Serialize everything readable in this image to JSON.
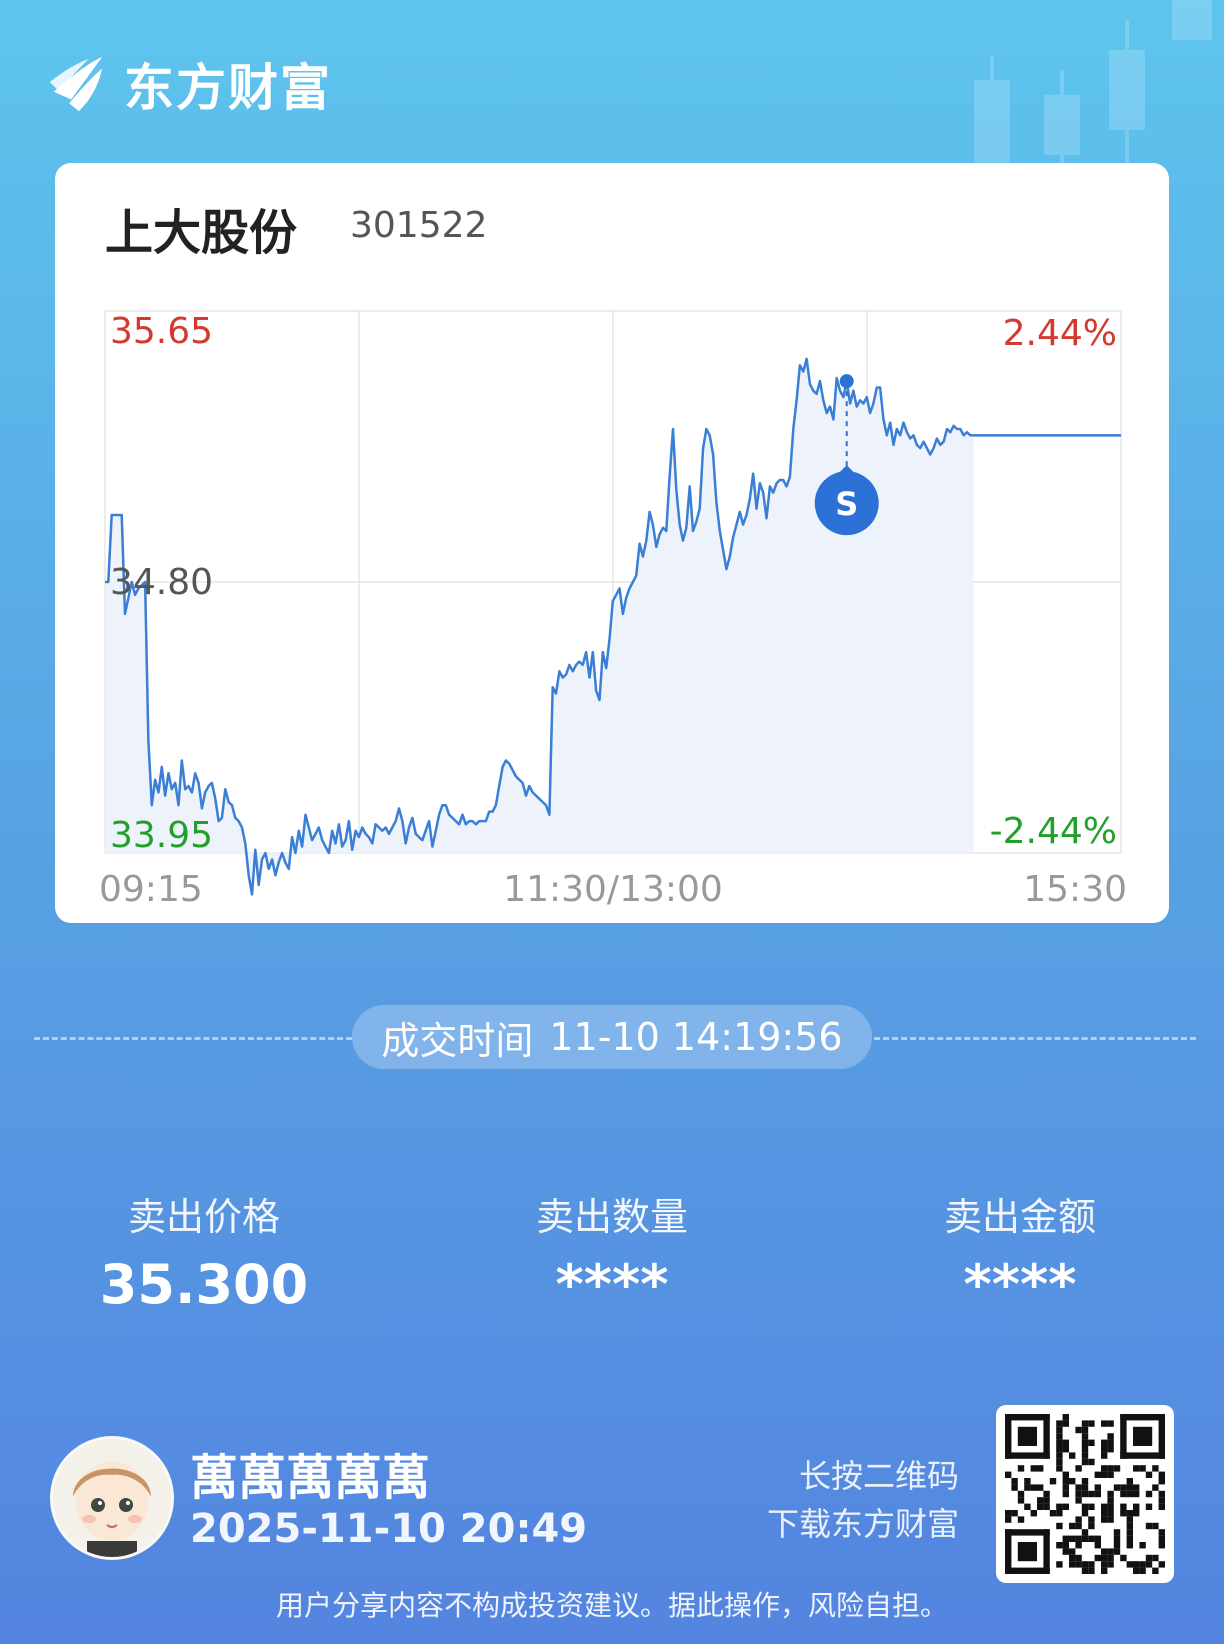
{
  "brand": {
    "name": "东方财富",
    "logo_icon": "eastmoney-logo-icon"
  },
  "stock": {
    "name": "上大股份",
    "code": "301522"
  },
  "chart_data": {
    "type": "line",
    "x_ticks": [
      "09:15",
      "11:30/13:00",
      "15:30"
    ],
    "y_left_labels": {
      "top": "35.65",
      "mid": "34.80",
      "bottom": "33.95"
    },
    "y_right_labels": {
      "top": "2.44%",
      "bottom": "-2.44%"
    },
    "ylim": [
      33.95,
      35.65
    ],
    "base_price": 34.8,
    "line_color": "#3a7fd5",
    "fill_color": "#eef3fb",
    "up_color": "#d33a2f",
    "down_color": "#22a02a",
    "grid": true,
    "series": [
      {
        "values": [
          34.8,
          34.8,
          35.01,
          35.01,
          35.01,
          35.01,
          34.7,
          34.75,
          34.8,
          34.76,
          34.78,
          34.79,
          34.8,
          34.3,
          34.1,
          34.18,
          34.14,
          34.22,
          34.13,
          34.2,
          34.15,
          34.17,
          34.1,
          34.24,
          34.15,
          34.16,
          34.14,
          34.2,
          34.17,
          34.09,
          34.14,
          34.16,
          34.17,
          34.12,
          34.05,
          34.06,
          34.15,
          34.11,
          34.1,
          34.06,
          34.05,
          34.03,
          33.98,
          33.88,
          33.82,
          33.96,
          33.85,
          33.93,
          33.95,
          33.9,
          33.93,
          33.88,
          33.92,
          33.95,
          33.92,
          33.9,
          34.0,
          33.95,
          34.02,
          33.97,
          34.07,
          34.03,
          33.99,
          34.01,
          34.03,
          33.99,
          33.97,
          33.95,
          34.02,
          33.98,
          34.04,
          33.97,
          33.99,
          34.05,
          33.96,
          34.02,
          34.0,
          34.03,
          34.01,
          34.0,
          33.98,
          34.04,
          34.03,
          34.02,
          34.03,
          34.01,
          34.03,
          34.05,
          34.09,
          34.05,
          33.98,
          34.03,
          34.06,
          34.01,
          34.0,
          33.99,
          34.02,
          34.05,
          33.97,
          34.02,
          34.07,
          34.1,
          34.1,
          34.07,
          34.06,
          34.05,
          34.04,
          34.07,
          34.04,
          34.05,
          34.05,
          34.04,
          34.05,
          34.05,
          34.05,
          34.08,
          34.08,
          34.1,
          34.16,
          34.22,
          34.24,
          34.23,
          34.21,
          34.19,
          34.18,
          34.17,
          34.13,
          34.16,
          34.14,
          34.13,
          34.12,
          34.11,
          34.1,
          34.07,
          34.47,
          34.45,
          34.52,
          34.5,
          34.51,
          34.54,
          34.52,
          34.54,
          34.55,
          34.54,
          34.58,
          34.5,
          34.58,
          34.46,
          34.43,
          34.58,
          34.53,
          34.62,
          34.74,
          34.76,
          34.78,
          34.7,
          34.75,
          34.78,
          34.8,
          34.82,
          34.92,
          34.88,
          34.93,
          35.02,
          34.98,
          34.91,
          34.95,
          34.97,
          34.96,
          35.13,
          35.28,
          35.09,
          34.98,
          34.93,
          34.97,
          35.1,
          34.96,
          34.99,
          35.03,
          35.22,
          35.28,
          35.26,
          35.2,
          35.05,
          34.96,
          34.9,
          34.84,
          34.88,
          34.94,
          34.98,
          35.02,
          34.98,
          35.01,
          35.06,
          35.14,
          35.03,
          35.11,
          35.08,
          35.0,
          35.1,
          35.08,
          35.11,
          35.12,
          35.12,
          35.1,
          35.13,
          35.28,
          35.37,
          35.48,
          35.46,
          35.5,
          35.42,
          35.4,
          35.39,
          35.43,
          35.37,
          35.33,
          35.35,
          35.31,
          35.44,
          35.4,
          35.38,
          35.43,
          35.36,
          35.4,
          35.35,
          35.37,
          35.36,
          35.38,
          35.33,
          35.36,
          35.41,
          35.41,
          35.31,
          35.26,
          35.3,
          35.23,
          35.28,
          35.26,
          35.3,
          35.27,
          35.25,
          35.26,
          35.23,
          35.22,
          35.24,
          35.22,
          35.2,
          35.22,
          35.25,
          35.23,
          35.24,
          35.28,
          35.27,
          35.29,
          35.28,
          35.28,
          35.26,
          35.27,
          35.26,
          35.26
        ]
      }
    ],
    "after_close_value": 35.26,
    "trade_marker": {
      "label": "S",
      "point_index": 222,
      "color": "#2c72d6"
    }
  },
  "trade": {
    "time_label": "成交时间",
    "time_value": "11-10 14:19:56"
  },
  "stats": [
    {
      "label": "卖出价格",
      "value": "35.300"
    },
    {
      "label": "卖出数量",
      "value": "****"
    },
    {
      "label": "卖出金额",
      "value": "****"
    }
  ],
  "user": {
    "name": "萬萬萬萬萬",
    "datetime": "2025-11-10 20:49",
    "avatar_icon": "avatar-icon"
  },
  "qr": {
    "line1": "长按二维码",
    "line2": "下载东方财富",
    "icon": "qr-code-icon"
  },
  "disclaimer": "用户分享内容不构成投资建议。据此操作，风险自担。"
}
